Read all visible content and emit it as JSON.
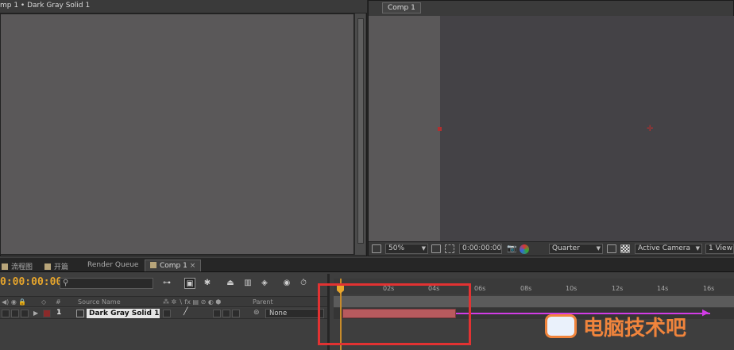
{
  "layer_panel": {
    "title": "mp 1 • Dark Gray Solid 1"
  },
  "comp_panel": {
    "tab": "Comp 1",
    "toolbar": {
      "zoom": "50%",
      "timecode": "0:00:00:00",
      "resolution": "Quarter",
      "camera": "Active Camera",
      "views": "1 View"
    }
  },
  "tabs": [
    {
      "label": "流程图"
    },
    {
      "label": "开篇"
    },
    {
      "label": "Render Queue"
    },
    {
      "label": "Comp 1"
    }
  ],
  "timeline": {
    "time": "0:00:00:00",
    "columns": {
      "num": "#",
      "source": "Source Name",
      "parent": "Parent"
    },
    "layer": {
      "num": "1",
      "name": "Dark Gray Solid 1",
      "parent": "None"
    },
    "ruler": [
      "02s",
      "04s",
      "06s",
      "08s",
      "10s",
      "12s",
      "14s",
      "16s"
    ]
  },
  "watermark": "电脑技术吧",
  "colors": {
    "accent": "#e8a62c",
    "highlight": "#e23232",
    "layer_bar": "#b85a5e",
    "arrow": "#d23ce6"
  }
}
